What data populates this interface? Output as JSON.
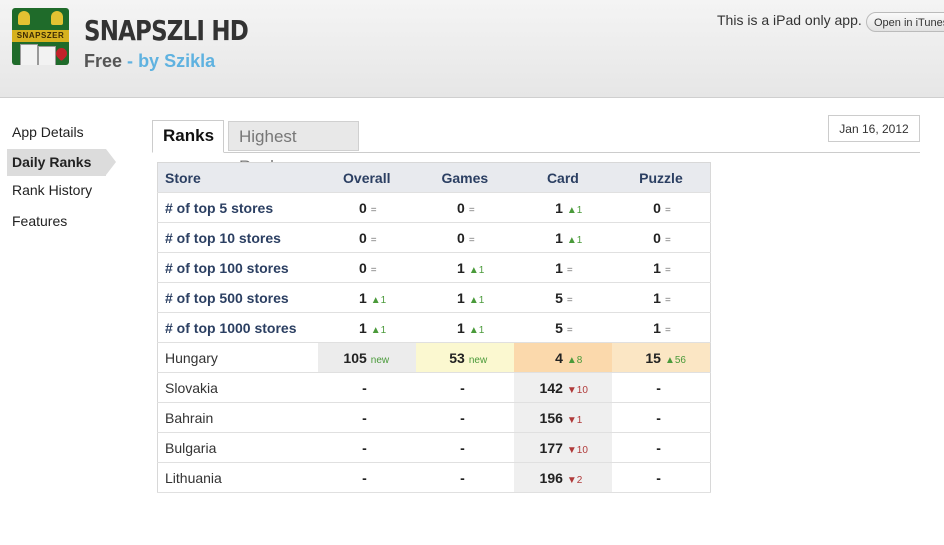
{
  "header": {
    "app_name": "SNAPSZLI HD",
    "price": "Free",
    "separator": "-",
    "author": "by Szikla",
    "icon_banner": "SNAPSZER",
    "ipad_note": "This is a iPad only app.",
    "open_button": "Open in iTunes"
  },
  "sidebar": {
    "items": [
      {
        "label": "App Details"
      },
      {
        "label": "Daily Ranks"
      },
      {
        "label": "Rank History"
      },
      {
        "label": "Features"
      }
    ]
  },
  "tabs": {
    "ranks": "Ranks",
    "highest": "Highest Ranks"
  },
  "date": "Jan 16, 2012",
  "table": {
    "headers": [
      "Store",
      "Overall",
      "Games",
      "Card",
      "Puzzle"
    ],
    "rows": [
      {
        "label": "# of top 5 stores",
        "cells": [
          {
            "v": "0",
            "d": "="
          },
          {
            "v": "0",
            "d": "="
          },
          {
            "v": "1",
            "d": "▲1"
          },
          {
            "v": "0",
            "d": "="
          }
        ]
      },
      {
        "label": "# of top 10 stores",
        "cells": [
          {
            "v": "0",
            "d": "="
          },
          {
            "v": "0",
            "d": "="
          },
          {
            "v": "1",
            "d": "▲1"
          },
          {
            "v": "0",
            "d": "="
          }
        ]
      },
      {
        "label": "# of top 100 stores",
        "cells": [
          {
            "v": "0",
            "d": "="
          },
          {
            "v": "1",
            "d": "▲1"
          },
          {
            "v": "1",
            "d": "="
          },
          {
            "v": "1",
            "d": "="
          }
        ]
      },
      {
        "label": "# of top 500 stores",
        "cells": [
          {
            "v": "1",
            "d": "▲1"
          },
          {
            "v": "1",
            "d": "▲1"
          },
          {
            "v": "5",
            "d": "="
          },
          {
            "v": "1",
            "d": "="
          }
        ]
      },
      {
        "label": "# of top 1000 stores",
        "cells": [
          {
            "v": "1",
            "d": "▲1"
          },
          {
            "v": "1",
            "d": "▲1"
          },
          {
            "v": "5",
            "d": "="
          },
          {
            "v": "1",
            "d": "="
          }
        ]
      },
      {
        "label": "Hungary",
        "cells": [
          {
            "v": "105",
            "d": "new"
          },
          {
            "v": "53",
            "d": "new"
          },
          {
            "v": "4",
            "d": "▲8"
          },
          {
            "v": "15",
            "d": "▲56"
          }
        ]
      },
      {
        "label": "Slovakia",
        "cells": [
          {
            "v": "-",
            "d": ""
          },
          {
            "v": "-",
            "d": ""
          },
          {
            "v": "142",
            "d": "▼10"
          },
          {
            "v": "-",
            "d": ""
          }
        ]
      },
      {
        "label": "Bahrain",
        "cells": [
          {
            "v": "-",
            "d": ""
          },
          {
            "v": "-",
            "d": ""
          },
          {
            "v": "156",
            "d": "▼1"
          },
          {
            "v": "-",
            "d": ""
          }
        ]
      },
      {
        "label": "Bulgaria",
        "cells": [
          {
            "v": "-",
            "d": ""
          },
          {
            "v": "-",
            "d": ""
          },
          {
            "v": "177",
            "d": "▼10"
          },
          {
            "v": "-",
            "d": ""
          }
        ]
      },
      {
        "label": "Lithuania",
        "cells": [
          {
            "v": "-",
            "d": ""
          },
          {
            "v": "-",
            "d": ""
          },
          {
            "v": "196",
            "d": "▼2"
          },
          {
            "v": "-",
            "d": ""
          }
        ]
      }
    ]
  },
  "colors": {
    "accent": "#5fb2e0",
    "header_text": "#2b3f62",
    "up": "#4a9a3a",
    "down": "#b03a3a",
    "highlight_orange": "#fbd9ac",
    "highlight_yellow": "#fbf8d0"
  }
}
